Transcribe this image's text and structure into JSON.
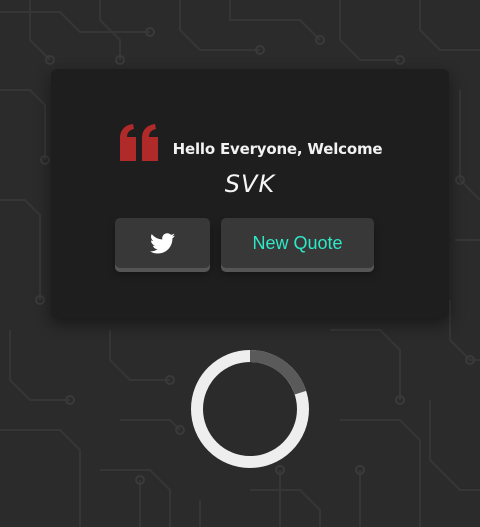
{
  "quote": {
    "text": "Hello Everyone, Welcome",
    "author": "SVK",
    "icon": "quote-icon",
    "accent_color": "#b02a2a"
  },
  "buttons": {
    "tweet_icon": "twitter-icon",
    "new_quote_label": "New Quote",
    "new_quote_color": "#2ee8c7"
  },
  "loader": {
    "icon": "loading-spinner",
    "progress": 0.2
  }
}
